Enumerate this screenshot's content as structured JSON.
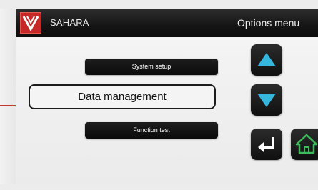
{
  "header": {
    "app_name": "SAHARA",
    "screen_title": "Options menu"
  },
  "menu": {
    "items": [
      {
        "label": "System setup",
        "selected": false
      },
      {
        "label": "Data management",
        "selected": true
      },
      {
        "label": "Function test",
        "selected": false
      }
    ]
  },
  "nav": {
    "up_icon": "up-triangle-icon",
    "down_icon": "down-triangle-icon",
    "enter_icon": "enter-return-icon",
    "home_icon": "home-icon"
  },
  "colors": {
    "accent_cyan": "#35b6de",
    "home_green": "#3dbb5a",
    "logo_red": "#c62828",
    "header_black": "#151515"
  }
}
